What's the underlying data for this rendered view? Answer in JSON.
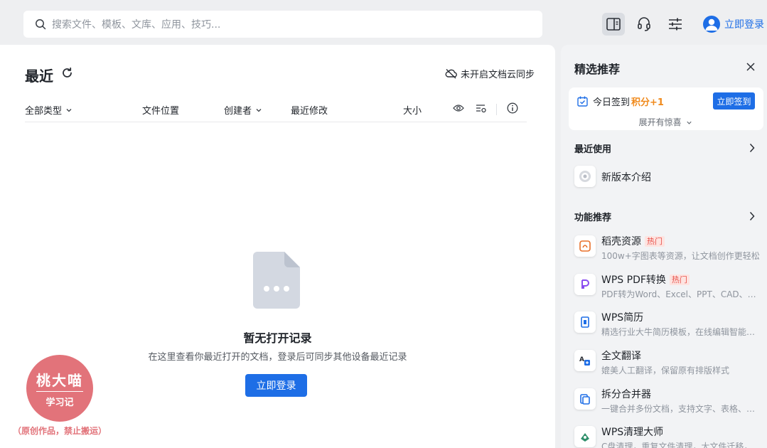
{
  "search": {
    "placeholder": "搜索文件、模板、文库、应用、技巧..."
  },
  "topbar": {
    "login_label": "立即登录"
  },
  "main": {
    "title": "最近",
    "sync_label": "未开启文档云同步",
    "columns": {
      "type": "全部类型",
      "location": "文件位置",
      "creator": "创建者",
      "modified": "最近修改",
      "size": "大小"
    },
    "empty_title": "暂无打开记录",
    "empty_desc": "在这里查看你最近打开的文档，登录后可同步其他设备最近记录",
    "login_label": "立即登录"
  },
  "watermark": {
    "name": "桃大喵",
    "sub": "学习记",
    "note": "（原创作品，禁止搬运）"
  },
  "side": {
    "title": "精选推荐",
    "signin": {
      "label": "今日签到",
      "points": "积分+1",
      "button": "立即签到",
      "more": "展开有惊喜"
    },
    "recent_title": "最近使用",
    "recent_items": [
      {
        "name": "新版本介绍"
      }
    ],
    "feature_title": "功能推荐",
    "features": [
      {
        "name": "稻壳资源",
        "hot": "热门",
        "desc": "100w+字图表等资源，让文档创作更轻松"
      },
      {
        "name": "WPS PDF转换",
        "hot": "热门",
        "desc": "PDF转为Word、Excel、PPT、CAD、拆分合并"
      },
      {
        "name": "WPS简历",
        "hot": "",
        "desc": "精选行业大牛简历模板，在线编辑智能排版"
      },
      {
        "name": "全文翻译",
        "hot": "",
        "desc": "媲美人工翻译，保留原有排版样式"
      },
      {
        "name": "拆分合并器",
        "hot": "",
        "desc": "一键合并多份文档，支持文字、表格、演示"
      },
      {
        "name": "WPS清理大师",
        "hot": "",
        "desc": "C盘清理，重复文件清理，大文件迁移，清理"
      }
    ]
  },
  "colors": {
    "accent": "#1e6ee6",
    "points": "#f08a1c",
    "hot_bg": "#fde4e1",
    "hot_fg": "#e8514a",
    "badge": "#e2737a"
  }
}
